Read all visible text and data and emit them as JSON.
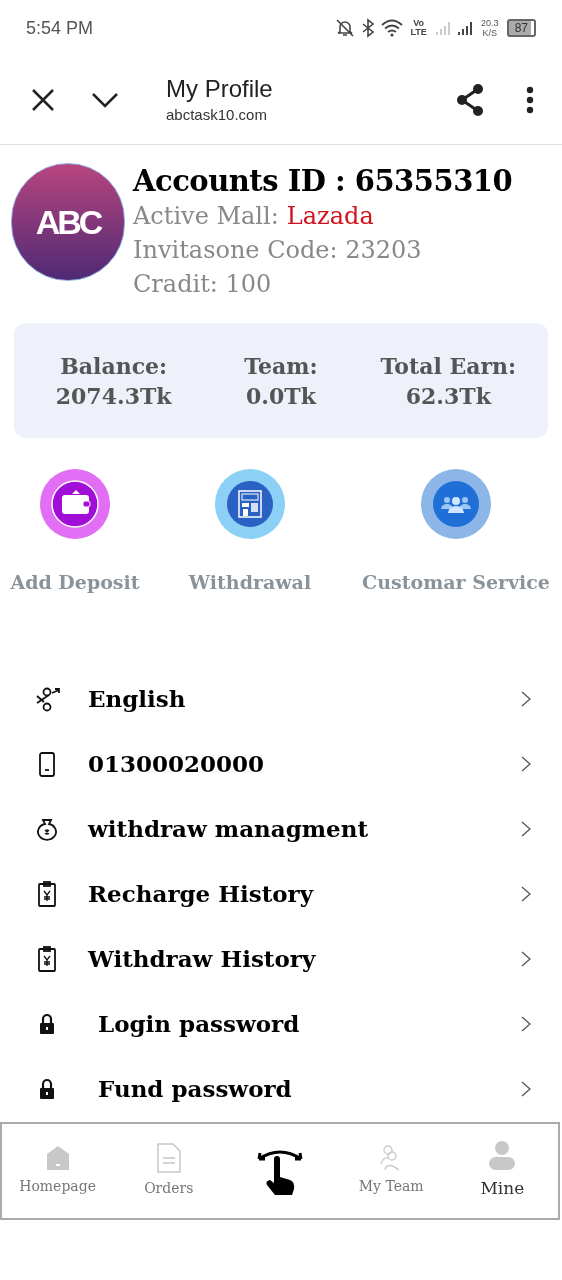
{
  "status_bar": {
    "time": "5:54 PM",
    "network": "Vo LTE",
    "speed": "20.3 K/S",
    "battery": "87"
  },
  "top_bar": {
    "title": "My Profile",
    "url": "abctask10.com"
  },
  "profile": {
    "logo": "ABC",
    "account_id": "Accounts ID : 65355310",
    "mall_label": "Active Mall:",
    "mall": "Lazada",
    "invite": "Invitasone Code: 23203",
    "credit": "Cradit: 100"
  },
  "stats": [
    {
      "label": "Balance:",
      "value": "2074.3Tk"
    },
    {
      "label": "Team:",
      "value": "0.0Tk"
    },
    {
      "label": "Total Earn:",
      "value": "62.3Tk"
    }
  ],
  "actions": [
    {
      "kind": "wallet",
      "label": "Add Deposit"
    },
    {
      "kind": "atm",
      "label": "Withdrawal"
    },
    {
      "kind": "people",
      "label": "Customar Service"
    }
  ],
  "menu": [
    {
      "kind": "language",
      "label": "English"
    },
    {
      "kind": "phone",
      "label": "01300020000"
    },
    {
      "kind": "moneybag",
      "label": "withdraw managment"
    },
    {
      "kind": "clipboard",
      "label": "Recharge History"
    },
    {
      "kind": "clipboard",
      "label": "Withdraw History"
    },
    {
      "kind": "lock",
      "label": "Login password"
    },
    {
      "kind": "lock",
      "label": "Fund password"
    }
  ],
  "bottom_nav": [
    {
      "kind": "home",
      "label": "Homepage",
      "selected": false
    },
    {
      "kind": "orders",
      "label": "Orders",
      "selected": false
    },
    {
      "kind": "gesture",
      "selected": false
    },
    {
      "kind": "team",
      "label": "My Team",
      "selected": false
    },
    {
      "kind": "mine",
      "label": "Mine",
      "selected": true
    }
  ]
}
